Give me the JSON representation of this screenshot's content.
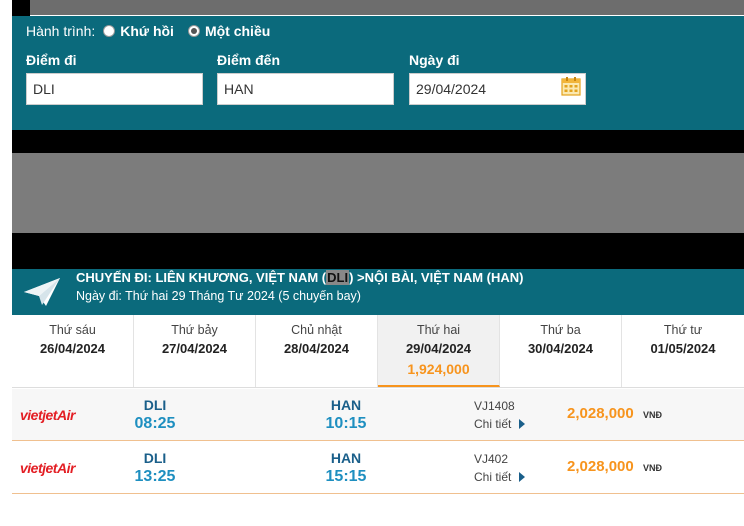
{
  "search": {
    "trip_label": "Hành trình:",
    "options": [
      {
        "label": "Khứ hồi",
        "checked": false
      },
      {
        "label": "Một chiều",
        "checked": true
      }
    ],
    "from_label": "Điểm đi",
    "from_value": "DLI",
    "to_label": "Điểm đến",
    "to_value": "HAN",
    "date_label": "Ngày đi",
    "date_value": "29/04/2024"
  },
  "route": {
    "title_prefix": "CHUYẾN ĐI: LIÊN KHƯƠNG, VIỆT NAM (",
    "title_code": "DLI",
    "title_suffix": ") >NỘI BÀI, VIỆT NAM (HAN)",
    "subtitle": "Ngày đi: Thứ hai 29 Tháng Tư 2024 (5 chuyến bay)"
  },
  "dates": [
    {
      "weekday": "Thứ sáu",
      "date": "26/04/2024",
      "price": ""
    },
    {
      "weekday": "Thứ bảy",
      "date": "27/04/2024",
      "price": ""
    },
    {
      "weekday": "Chủ nhật",
      "date": "28/04/2024",
      "price": ""
    },
    {
      "weekday": "Thứ hai",
      "date": "29/04/2024",
      "price": "1,924,000"
    },
    {
      "weekday": "Thứ ba",
      "date": "30/04/2024",
      "price": ""
    },
    {
      "weekday": "Thứ tư",
      "date": "01/05/2024",
      "price": ""
    }
  ],
  "flights": [
    {
      "airline": "VietJet Air",
      "from": "DLI",
      "dep": "08:25",
      "to": "HAN",
      "arr": "10:15",
      "flight_no": "VJ1408",
      "detail": "Chi tiết",
      "price": "2,028,000",
      "currency": "VNĐ"
    },
    {
      "airline": "VietJet Air",
      "from": "DLI",
      "dep": "13:25",
      "to": "HAN",
      "arr": "15:15",
      "flight_no": "VJ402",
      "detail": "Chi tiết",
      "price": "2,028,000",
      "currency": "VNĐ"
    }
  ],
  "colors": {
    "panel": "#0b6a7c",
    "accent": "#f7941d",
    "vietjet_red": "#e31e24"
  },
  "icons": {
    "calendar": "calendar-icon",
    "plane": "paper-plane-icon",
    "detail": "triangle-right-icon"
  }
}
